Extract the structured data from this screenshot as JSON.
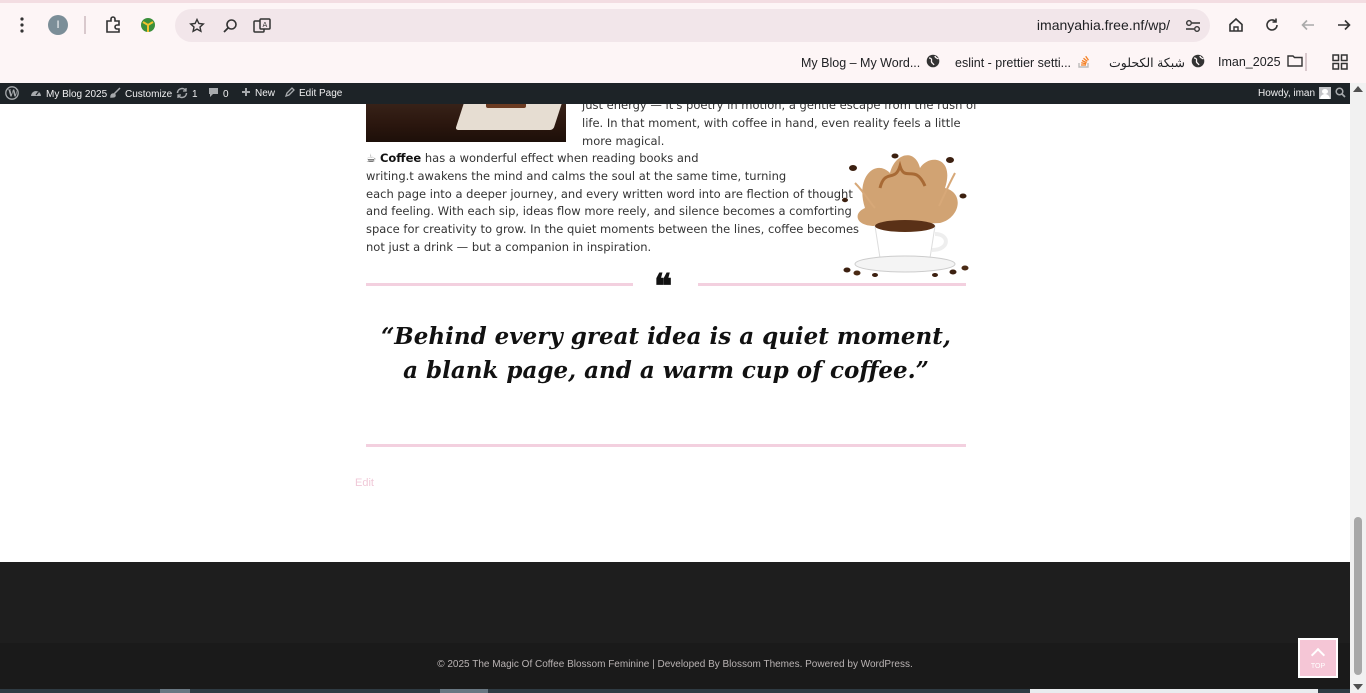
{
  "browser": {
    "avatar_letter": "I",
    "url": "imanyahia.free.nf/wp/",
    "bookmarks": [
      {
        "label": "My Blog – My Word...",
        "icon": "globe-icon"
      },
      {
        "label": "eslint - prettier setti...",
        "icon": "stackoverflow-icon"
      },
      {
        "label": "شبكة الكحلوت",
        "icon": "globe-icon"
      },
      {
        "label": "Iman_2025",
        "icon": "folder-icon"
      }
    ]
  },
  "admin_bar": {
    "site_name": "My Blog 2025",
    "customize": "Customize",
    "updates_count": "1",
    "comments_count": "0",
    "new_label": "New",
    "edit_page": "Edit Page",
    "howdy": "Howdy, iman"
  },
  "post": {
    "para_top_lines": [
      "just energy — it's poetry in motion, a gentle escape from the rush of",
      "life. In that moment, with coffee in hand, even reality feels a little",
      "more magical."
    ],
    "coffee_emoji": "☕",
    "coffee_bold": "Coffee",
    "coffee_line1_rest": " has a wonderful effect when reading books and",
    "coffee_lines": [
      "writing.t awakens the mind and calms the soul at the same time, turning",
      "each page into a deeper journey, and every written word into are flection of thought",
      "and feeling. With each sip, ideas flow more  reely, and silence becomes a comforting",
      "space for creativity to grow. In the quiet moments between the lines, coffee becomes",
      "not just a drink — but a companion in inspiration."
    ],
    "quote_glyph": "❝",
    "quote_line1": "“Behind every great idea is a quiet moment,",
    "quote_line2": "a blank page, and a warm cup of coffee.”",
    "edit_label": "Edit"
  },
  "footer": {
    "copyright": "© 2025 The Magic Of Coffee Blossom Feminine | Developed By Blossom Themes. Powered by WordPress.",
    "to_top_label": "TOP"
  },
  "colors": {
    "accent_pink": "#f5c6d6",
    "divider_pink": "#f3d0df",
    "admin_bar": "#1d2327",
    "footer_dark": "#1e1e1e"
  }
}
